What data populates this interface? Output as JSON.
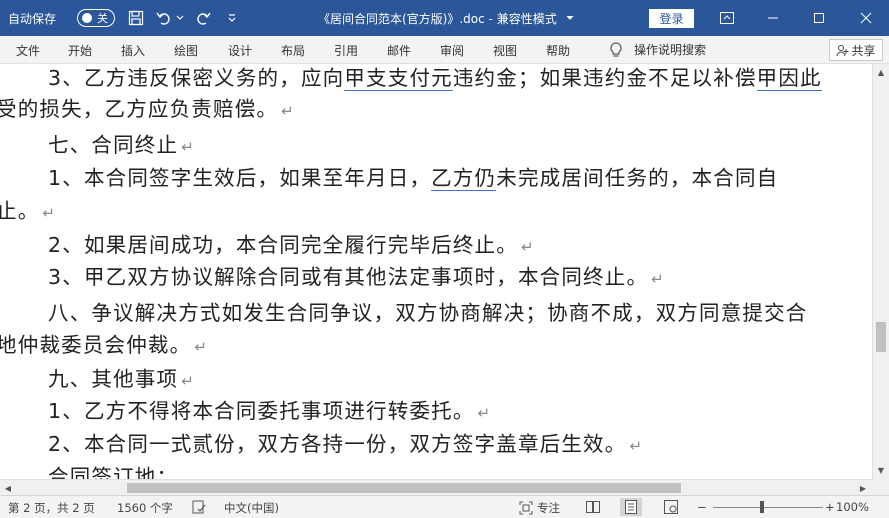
{
  "titlebar": {
    "autosave_label": "自动保存",
    "autosave_state": "关",
    "document_title": "《居间合同范本(官方版)》.doc  -  兼容性模式",
    "login_label": "登录",
    "icons": [
      "save-icon",
      "undo-icon",
      "redo-icon",
      "customize-qat-icon",
      "ribbon-display-icon",
      "minimize-icon",
      "maximize-icon",
      "close-icon"
    ]
  },
  "ribbon": {
    "tabs": [
      "文件",
      "开始",
      "插入",
      "绘图",
      "设计",
      "布局",
      "引用",
      "邮件",
      "审阅",
      "视图",
      "帮助"
    ],
    "search_label": "操作说明搜索",
    "share_label": "共享"
  },
  "document": {
    "lines": [
      {
        "segments": [
          {
            "text": "3、乙方违反保密义务的，应向"
          },
          {
            "text": "甲支支付元",
            "underline": true
          },
          {
            "text": "违约金；如果违约金不足以补偿"
          },
          {
            "text": "甲因此",
            "underline": true
          }
        ]
      },
      {
        "segments": [
          {
            "text": "受的损失，乙方应负责赔偿。"
          }
        ],
        "mark": "↵"
      },
      {
        "segments": [
          {
            "text": "七、合同终止"
          }
        ],
        "mark": "↵"
      },
      {
        "segments": [
          {
            "text": "1、本合同签字生效后，如果至年月日，"
          },
          {
            "text": "乙方仍",
            "underline": true
          },
          {
            "text": "未完成居间任务的，本合同自"
          }
        ]
      },
      {
        "segments": [
          {
            "text": "止。"
          }
        ],
        "mark": "↵"
      },
      {
        "segments": [
          {
            "text": "2、如果居间成功，本合同完全履行完毕后终止。"
          }
        ],
        "mark": "↵"
      },
      {
        "segments": [
          {
            "text": "3、甲乙双方协议解除合同或有其他法定事项时，本合同终止。"
          }
        ],
        "mark": "↵"
      },
      {
        "segments": [
          {
            "text": "八、争议解决方式如发生合同争议，双方协商解决；协商不成，双方同意提交合"
          }
        ]
      },
      {
        "segments": [
          {
            "text": "地仲裁委员会仲裁。"
          }
        ],
        "mark": "↵"
      },
      {
        "segments": [
          {
            "text": "九、其他事项"
          }
        ],
        "mark": "↵"
      },
      {
        "segments": [
          {
            "text": "1、乙方不得将本合同委托事项进行转委托。"
          }
        ],
        "mark": "↵"
      },
      {
        "segments": [
          {
            "text": "2、本合同一式贰份，双方各持一份，双方签字盖章后生效。"
          }
        ],
        "mark": "↵"
      },
      {
        "segments": [
          {
            "text": "合同签订地："
          }
        ]
      }
    ]
  },
  "statusbar": {
    "page": "第 2 页，共 2 页",
    "words": "1560 个字",
    "language": "中文(中国)",
    "focus": "专注",
    "zoom": "100%",
    "zoom_minus": "−",
    "zoom_plus": "+"
  }
}
